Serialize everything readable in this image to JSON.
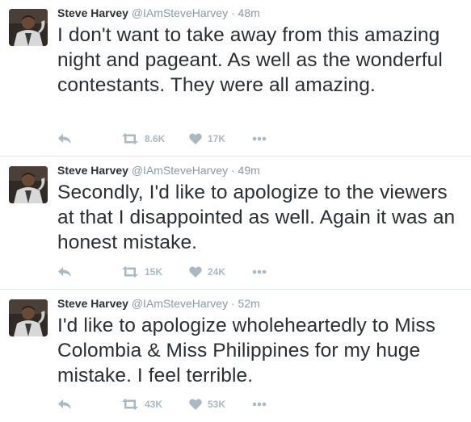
{
  "tweets": [
    {
      "name": "Steve Harvey",
      "handle": "@IAmSteveHarvey",
      "separator": "·",
      "time": "48m",
      "text": "I don't want to take away from this amazing night and pageant. As well as the wonderful contestants. They were all amazing.",
      "retweets": "8.6K",
      "likes": "17K"
    },
    {
      "name": "Steve Harvey",
      "handle": "@IAmSteveHarvey",
      "separator": "·",
      "time": "49m",
      "text": "Secondly, I'd like to apologize to the viewers at that I disappointed as well. Again it was an honest mistake.",
      "retweets": "15K",
      "likes": "24K"
    },
    {
      "name": "Steve Harvey",
      "handle": "@IAmSteveHarvey",
      "separator": "·",
      "time": "52m",
      "text": "I'd like to apologize wholeheartedly to Miss Colombia & Miss Philippines for my huge mistake. I feel terrible.",
      "retweets": "43K",
      "likes": "53K"
    }
  ],
  "colors": {
    "text": "#292f33",
    "muted": "#8899a6",
    "action": "#aab8c2",
    "divider": "#e1e8ed"
  },
  "icons": [
    "avatar",
    "reply-icon",
    "retweet-icon",
    "heart-icon",
    "more-icon"
  ]
}
